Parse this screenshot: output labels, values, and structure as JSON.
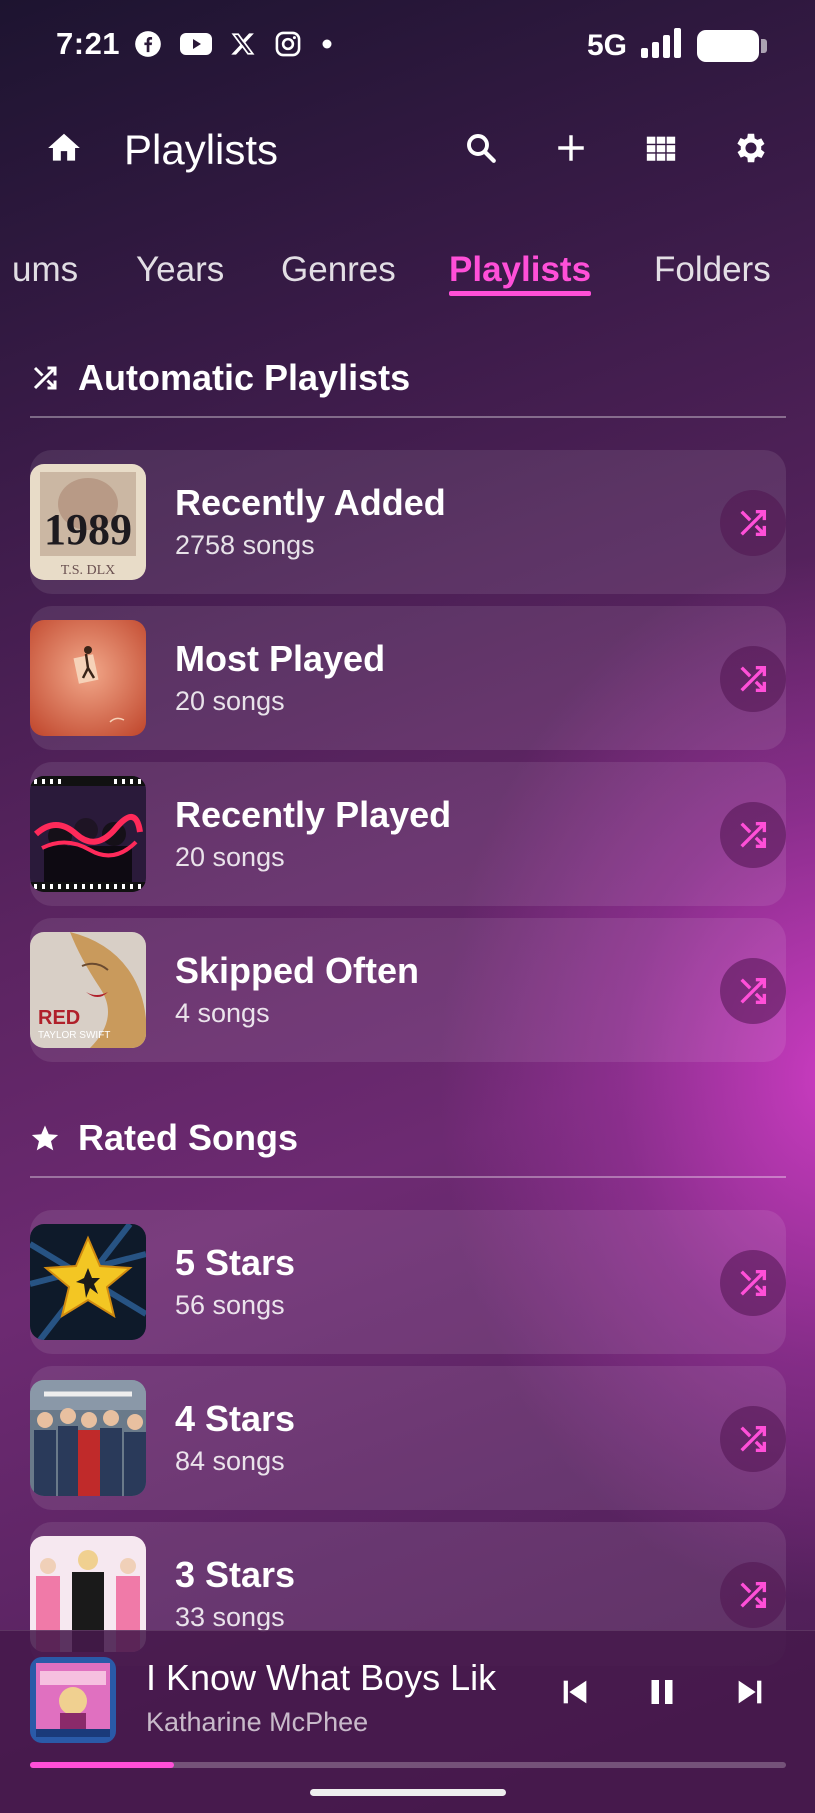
{
  "status_bar": {
    "time": "7:21",
    "network": "5G",
    "icons": [
      "facebook-icon",
      "youtube-icon",
      "x-icon",
      "instagram-icon",
      "dot-icon"
    ]
  },
  "header": {
    "title": "Playlists",
    "actions": [
      "search-icon",
      "plus-icon",
      "grid-icon",
      "gear-icon"
    ]
  },
  "tabs": [
    {
      "label": "ums"
    },
    {
      "label": "Years"
    },
    {
      "label": "Genres"
    },
    {
      "label": "Playlists",
      "active": true
    },
    {
      "label": "Folders"
    }
  ],
  "sections": {
    "automatic": {
      "title": "Automatic Playlists",
      "items": [
        {
          "name": "Recently Added",
          "count": "2758 songs"
        },
        {
          "name": "Most Played",
          "count": "20 songs"
        },
        {
          "name": "Recently Played",
          "count": "20 songs"
        },
        {
          "name": "Skipped Often",
          "count": "4 songs"
        }
      ]
    },
    "rated": {
      "title": "Rated Songs",
      "items": [
        {
          "name": "5 Stars",
          "count": "56 songs"
        },
        {
          "name": "4 Stars",
          "count": "84 songs"
        },
        {
          "name": "3 Stars",
          "count": "33 songs"
        }
      ]
    }
  },
  "album_art_text": {
    "recently_added": "1989",
    "recently_added_sub": "T.S. DLX",
    "skipped_often_top": "RED",
    "skipped_often_bottom": "TAYLOR SWIFT"
  },
  "now_playing": {
    "title": "I Know What Boys Lik",
    "artist": "Katharine McPhee",
    "progress": 0.19
  },
  "colors": {
    "accent": "#ff4fd8",
    "background_dark": "#1d1430",
    "background_glow": "#ce3cc4"
  }
}
